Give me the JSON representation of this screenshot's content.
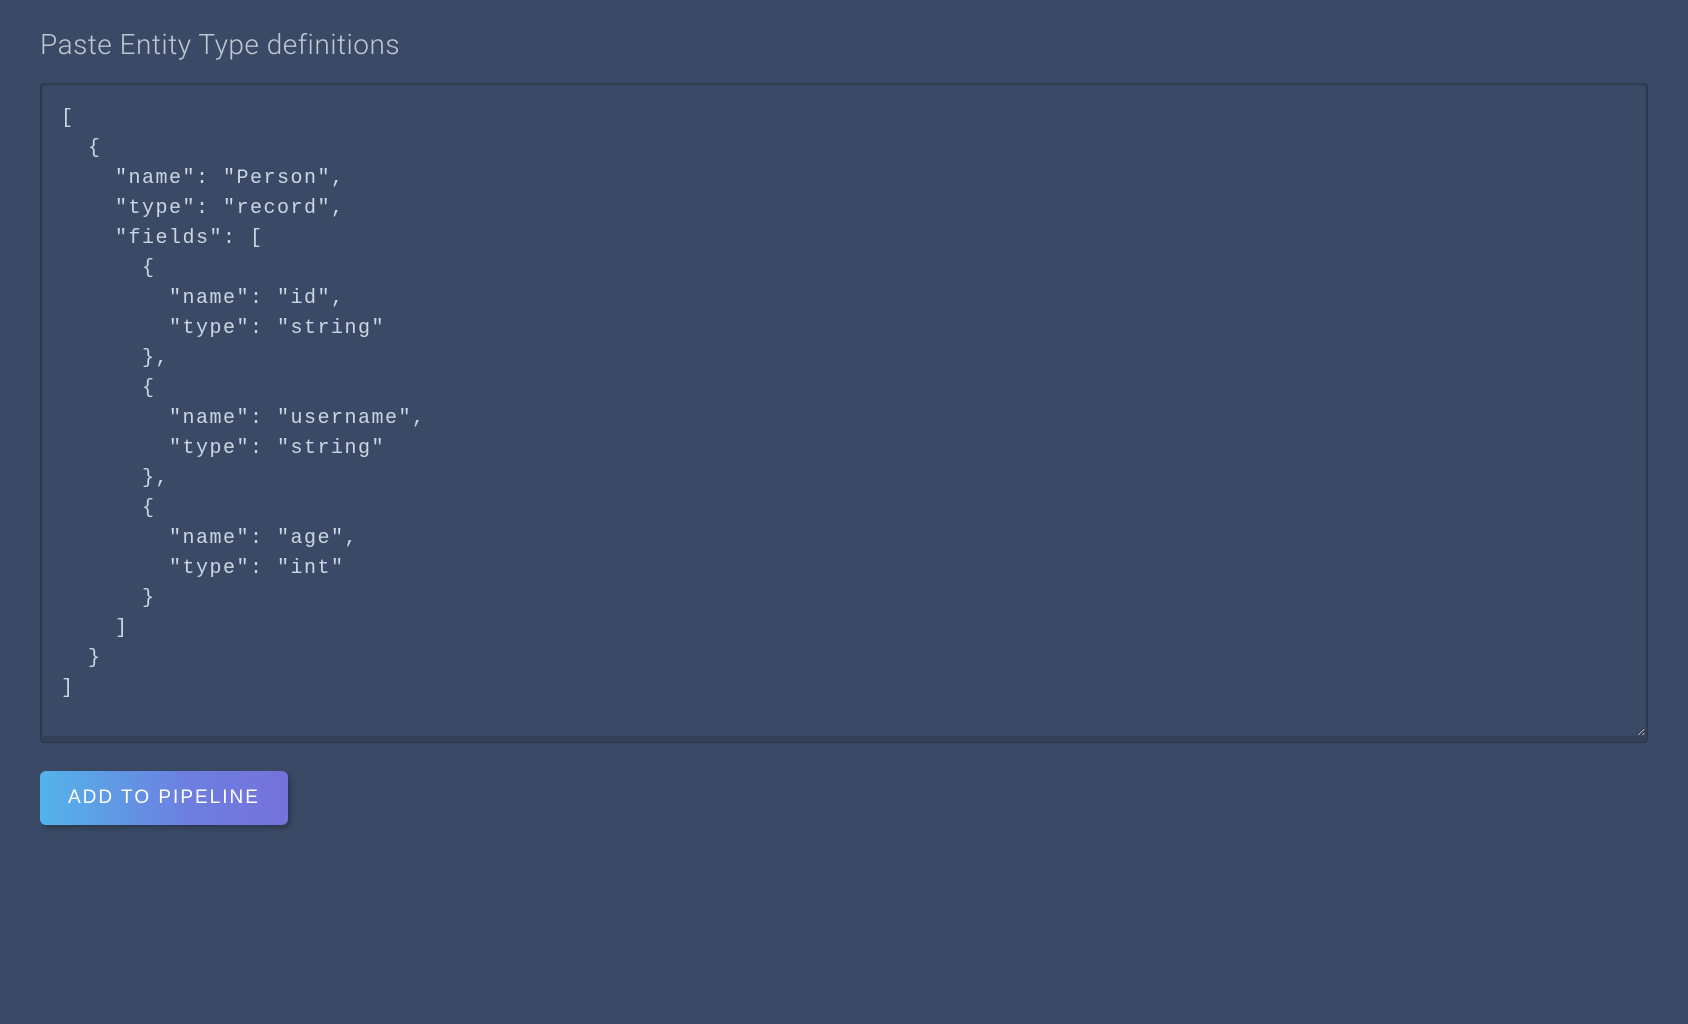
{
  "heading": "Paste Entity Type definitions",
  "textarea": {
    "value": "[\n  {\n    \"name\": \"Person\",\n    \"type\": \"record\",\n    \"fields\": [\n      {\n        \"name\": \"id\",\n        \"type\": \"string\"\n      },\n      {\n        \"name\": \"username\",\n        \"type\": \"string\"\n      },\n      {\n        \"name\": \"age\",\n        \"type\": \"int\"\n      }\n    ]\n  }\n]"
  },
  "button": {
    "label": "ADD TO PIPELINE"
  }
}
